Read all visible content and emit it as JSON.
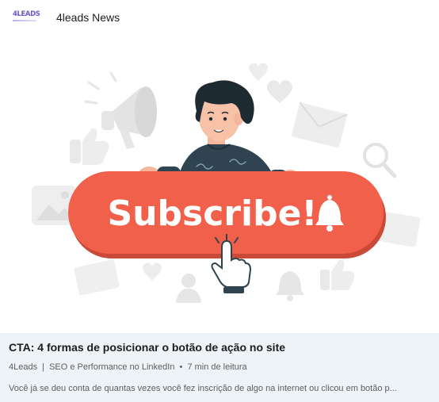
{
  "header": {
    "logo_text": "4LEADS",
    "newsletter_name": "4leads News"
  },
  "hero": {
    "button_text": "Subscribe!",
    "icons": [
      "megaphone-icon",
      "heart-icon",
      "envelope-icon",
      "search-icon",
      "thumbs-up-icon",
      "image-icon",
      "bell-icon",
      "user-icon",
      "pointer-hand-icon"
    ],
    "colors": {
      "button": "#f0604a",
      "button_shadow": "#c94a38",
      "shirt": "#2f4450",
      "hair": "#1e2a32",
      "decor": "#e8e8e8"
    }
  },
  "article": {
    "title": "CTA: 4 formas de posicionar o botão de ação no site",
    "author": "4Leads",
    "publication": "SEO e Performance no LinkedIn",
    "read_time": "7 min de leitura",
    "excerpt": "Você já se deu conta de quantas vezes você fez inscrição de algo na internet ou clicou em botão p..."
  }
}
